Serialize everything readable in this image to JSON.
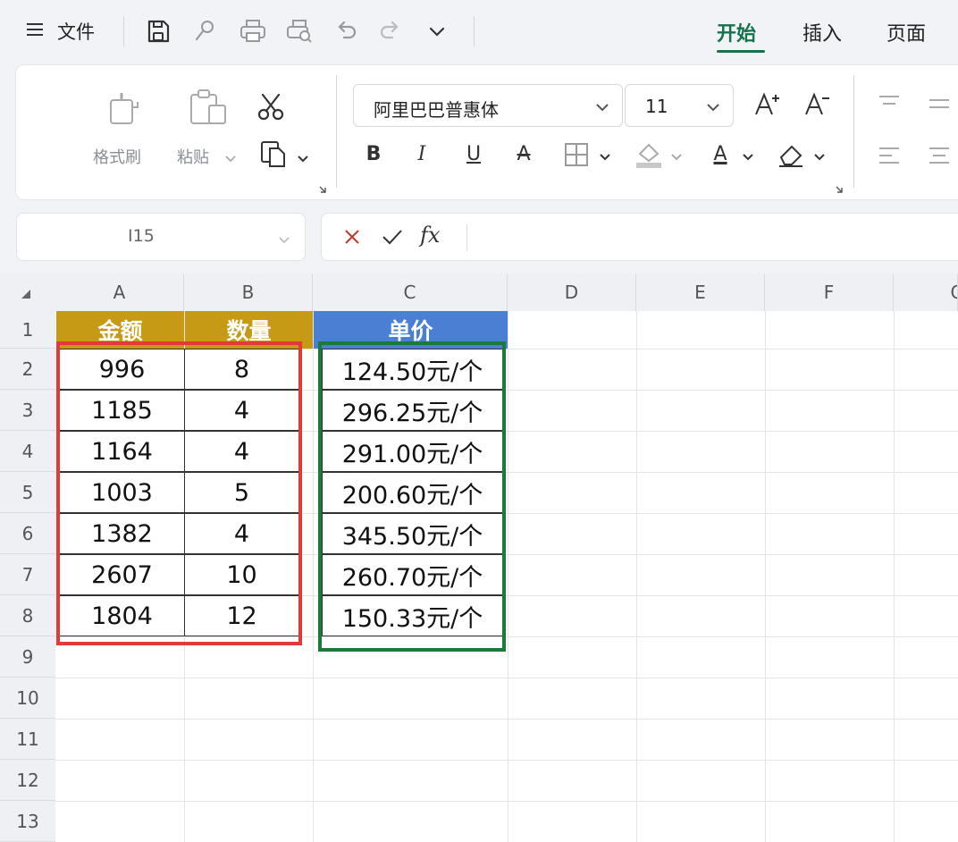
{
  "topbar": {
    "file_label": "文件",
    "icons": [
      "menu-icon",
      "save-icon",
      "brush-icon",
      "print-icon",
      "print-preview-icon",
      "undo-icon",
      "redo-icon",
      "chevron-down-icon"
    ],
    "tabs": [
      {
        "label": "开始",
        "active": true
      },
      {
        "label": "插入",
        "active": false
      },
      {
        "label": "页面",
        "active": false
      }
    ],
    "accent": "#16724a"
  },
  "ribbon": {
    "format_painter": "格式刷",
    "paste": "粘贴",
    "font_name": "阿里巴巴普惠体",
    "font_size": "11",
    "bold": "B",
    "italic": "I",
    "underline": "U",
    "strike": "A",
    "font_color_glyph": "A"
  },
  "formula_bar": {
    "cell_ref": "I15",
    "fx": "fx",
    "content": ""
  },
  "sheet": {
    "columns": [
      "A",
      "B",
      "C",
      "D",
      "E",
      "F",
      "G"
    ],
    "rows": [
      "1",
      "2",
      "3",
      "4",
      "5",
      "6",
      "7",
      "8",
      "9",
      "10",
      "11",
      "12",
      "13"
    ],
    "headers": {
      "a": {
        "text": "金额",
        "bg": "#c79a16"
      },
      "b": {
        "text": "数量",
        "bg": "#c79a16"
      },
      "c": {
        "text": "单价",
        "bg": "#4a7fd4"
      }
    },
    "data": [
      {
        "amount": "996",
        "qty": "8",
        "price": "124.50元/个"
      },
      {
        "amount": "1185",
        "qty": "4",
        "price": "296.25元/个"
      },
      {
        "amount": "1164",
        "qty": "4",
        "price": "291.00元/个"
      },
      {
        "amount": "1003",
        "qty": "5",
        "price": "200.60元/个"
      },
      {
        "amount": "1382",
        "qty": "4",
        "price": "345.50元/个"
      },
      {
        "amount": "2607",
        "qty": "10",
        "price": "260.70元/个"
      },
      {
        "amount": "1804",
        "qty": "12",
        "price": "150.33元/个"
      }
    ],
    "highlight_colors": {
      "red": "#e53935",
      "green": "#1a7a3a"
    }
  }
}
